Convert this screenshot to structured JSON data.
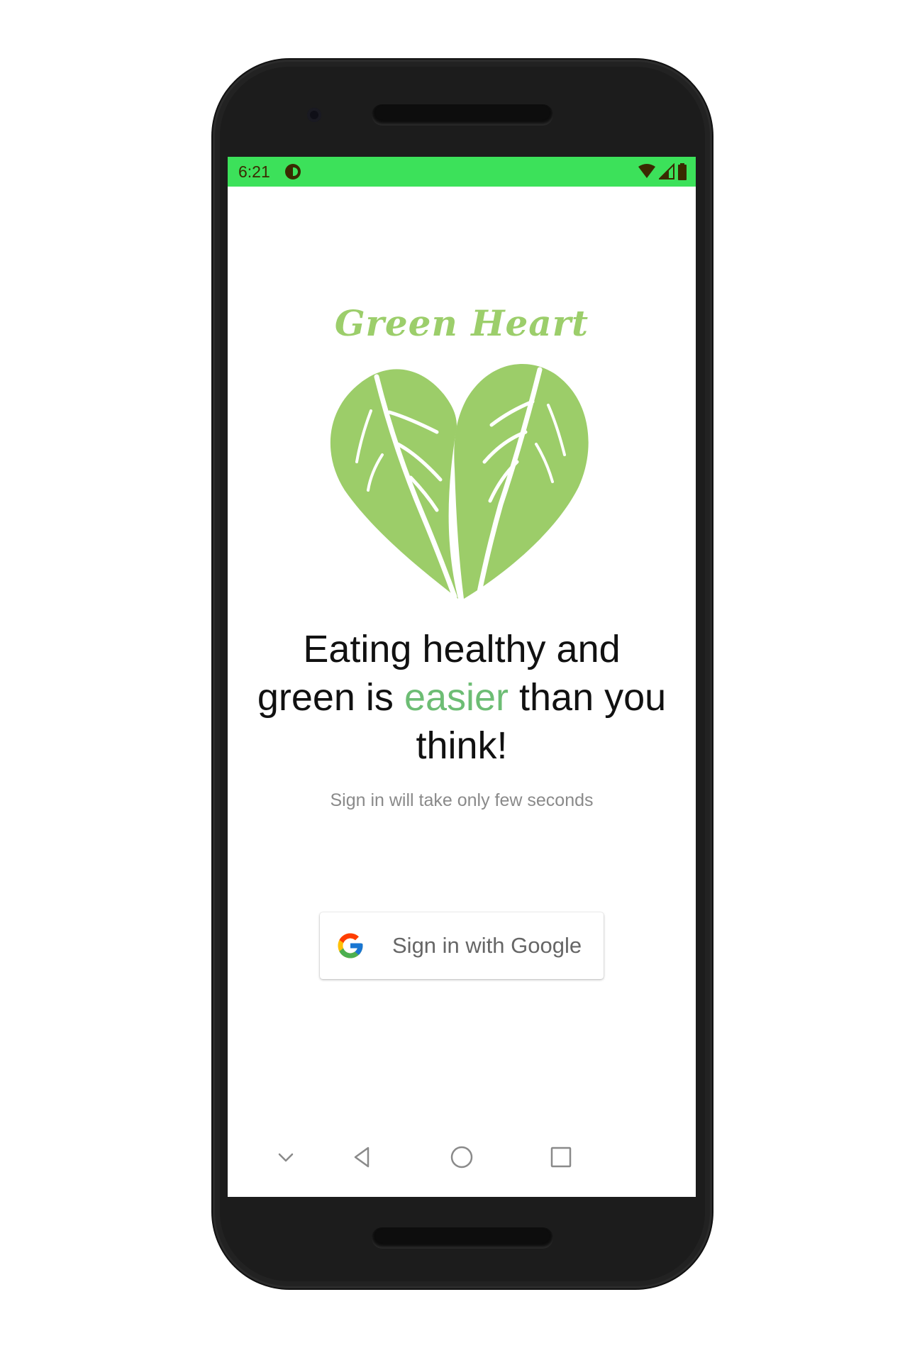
{
  "status_bar": {
    "time": "6:21",
    "background": "#3ce15a",
    "icons": [
      "app-notification-icon",
      "wifi-icon",
      "cell-signal-icon",
      "battery-icon"
    ]
  },
  "logo": {
    "title": "Green Heart",
    "color": "#9cce6b",
    "icon": "leaf-heart-icon"
  },
  "headline": {
    "part1": "Eating healthy and green is ",
    "accent": "easier",
    "part2": " than you think!",
    "accent_color": "#6dbd74"
  },
  "subtext": "Sign in will take only few seconds",
  "google_button": {
    "label": "Sign in with Google",
    "icon": "google-g-icon"
  },
  "nav_bar": {
    "items": [
      "chevron-down-icon",
      "back-icon",
      "home-icon",
      "recents-icon"
    ]
  }
}
